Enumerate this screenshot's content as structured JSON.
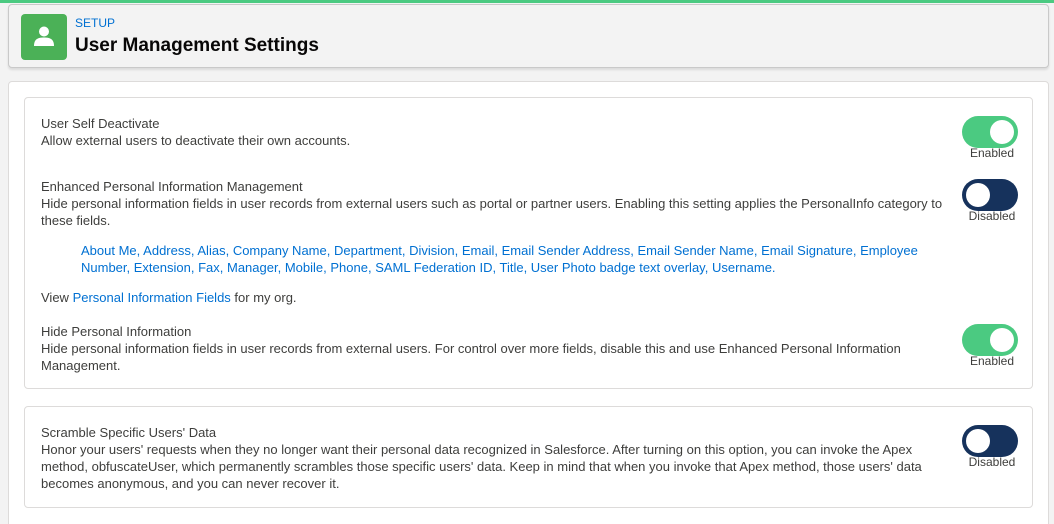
{
  "header": {
    "eyebrow": "SETUP",
    "title": "User Management Settings",
    "icon": "user-icon"
  },
  "settings": {
    "self_deactivate": {
      "title": "User Self Deactivate",
      "description": "Allow external users to deactivate their own accounts.",
      "state": "Enabled"
    },
    "enhanced_pim": {
      "title": "Enhanced Personal Information Management",
      "description": "Hide personal information fields in user records from external users such as portal or partner users. Enabling this setting applies the PersonalInfo category to these fields.",
      "state": "Disabled",
      "fields": [
        "About Me",
        "Address",
        "Alias",
        "Company Name",
        "Department",
        "Division",
        "Email",
        "Email Sender Address",
        "Email Sender Name",
        "Email Signature",
        "Employee Number",
        "Extension",
        "Fax",
        "Manager",
        "Mobile",
        "Phone",
        "SAML Federation ID",
        "Title",
        "User Photo badge text overlay",
        "Username"
      ],
      "view_prefix": "View ",
      "view_link": "Personal Information Fields",
      "view_suffix": " for my org."
    },
    "hide_pi": {
      "title": "Hide Personal Information",
      "description": "Hide personal information fields in user records from external users. For control over more fields, disable this and use Enhanced Personal Information Management.",
      "state": "Enabled"
    },
    "scramble": {
      "title": "Scramble Specific Users' Data",
      "description": "Honor your users' requests when they no longer want their personal data recognized in Salesforce. After turning on this option, you can invoke the Apex method, obfuscateUser, which permanently scrambles those specific users' data. Keep in mind that when you invoke that Apex method, those users' data becomes anonymous, and you can never recover it.",
      "state": "Disabled"
    }
  },
  "colors": {
    "toggle_on": "#4bca81",
    "toggle_off": "#16325c",
    "link": "#0070d2",
    "header_icon_bg": "#4bb157"
  }
}
